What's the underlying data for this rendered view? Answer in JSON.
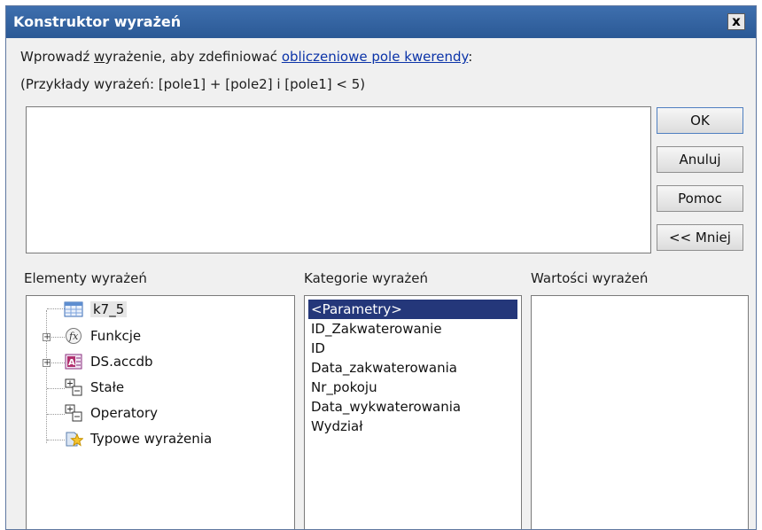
{
  "window": {
    "title": "Konstruktor wyrażeń",
    "close_label": "x"
  },
  "instructions": {
    "line1_prefix": "Wprowadź ",
    "line1_underlined": "w",
    "line1_rest": "yrażenie, aby zdefiniować ",
    "line1_link": "obliczeniowe pole kwerendy",
    "line1_suffix": ":",
    "line2": "(Przykłady wyrażeń: [pole1] + [pole2] i [pole1] < 5)"
  },
  "expression_input": {
    "value": ""
  },
  "buttons": {
    "ok": "OK",
    "cancel": "Anuluj",
    "help": "Pomoc",
    "less": "<< Mniej"
  },
  "panels": {
    "elements": {
      "header": "Elementy wyrażeń",
      "items": [
        {
          "label": "k7_5",
          "icon": "query-table-icon",
          "selected": true
        },
        {
          "label": "Funkcje",
          "icon": "function-icon",
          "expandable": true
        },
        {
          "label": "DS.accdb",
          "icon": "database-icon",
          "expandable": true
        },
        {
          "label": "Stałe",
          "icon": "constants-icon"
        },
        {
          "label": "Operatory",
          "icon": "operators-icon"
        },
        {
          "label": "Typowe wyrażenia",
          "icon": "common-expressions-icon"
        }
      ]
    },
    "categories": {
      "header": "Kategorie wyrażeń",
      "items": [
        "<Parametry>",
        "ID_Zakwaterowanie",
        "ID",
        "Data_zakwaterowania",
        "Nr_pokoju",
        "Data_wykwaterowania",
        "Wydział"
      ]
    },
    "values": {
      "header": "Wartości wyrażeń",
      "items": []
    }
  },
  "colors": {
    "titlebar": "#2f5f9e",
    "selection": "#24377a",
    "link": "#0b33a8"
  }
}
